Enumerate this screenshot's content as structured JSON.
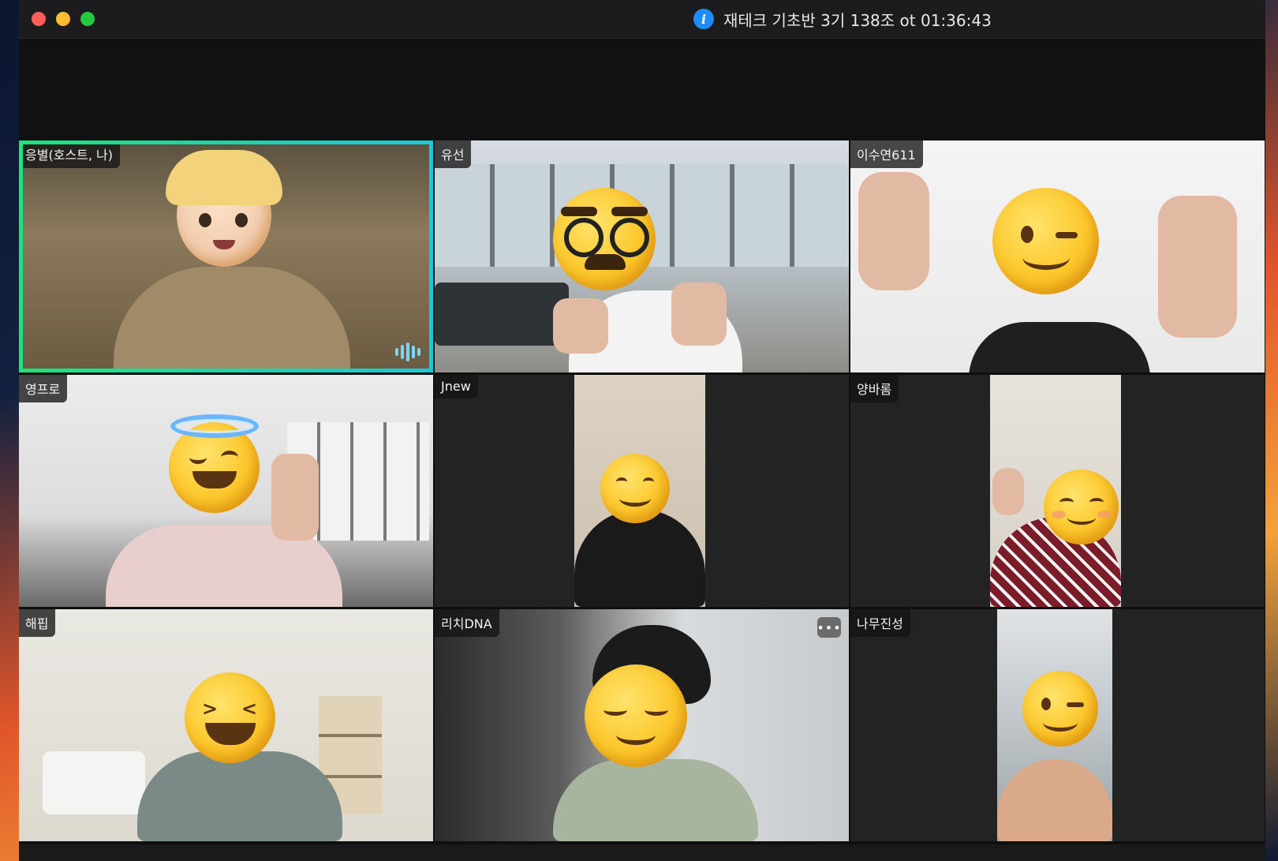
{
  "window": {
    "meeting_title": "재테크 기초반 3기 138조 ot 01:36:43"
  },
  "participants": [
    {
      "name": "응별(호스트, 나)"
    },
    {
      "name": "유선"
    },
    {
      "name": "이수연611"
    },
    {
      "name": "영프로"
    },
    {
      "name": "Jnew"
    },
    {
      "name": "양바롬"
    },
    {
      "name": "해핍"
    },
    {
      "name": "리치DNA"
    },
    {
      "name": "나무진성"
    }
  ],
  "icons": {
    "info": "info-icon",
    "speaking": "audio-wave-icon",
    "more": "more-options-icon"
  },
  "colors": {
    "active_speaker_border": "#22d673",
    "info_blue": "#1d8cf8"
  }
}
